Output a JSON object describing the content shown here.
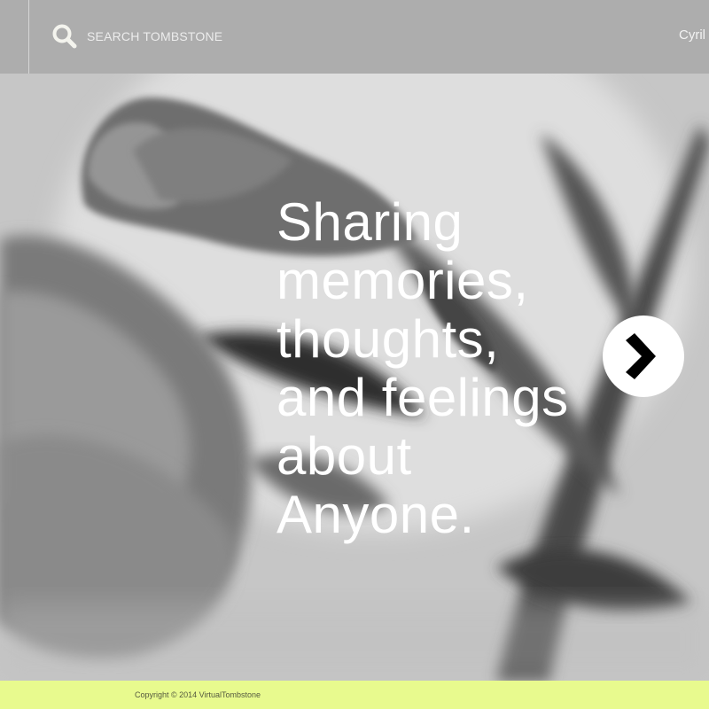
{
  "header": {
    "search_placeholder": "SEARCH TOMBSTONE",
    "user_name": "Cyril"
  },
  "hero": {
    "headline_lines": [
      "Sharing",
      "memories,",
      "thoughts,",
      "and feelings",
      "about",
      "Anyone."
    ],
    "next_icon": "chevron-right-icon"
  },
  "footer": {
    "copyright": "Copyright © 2014 VirtualTombstone"
  },
  "colors": {
    "topbar": "#adadad",
    "footer": "#e8fa8e",
    "headline": "#ffffff"
  }
}
